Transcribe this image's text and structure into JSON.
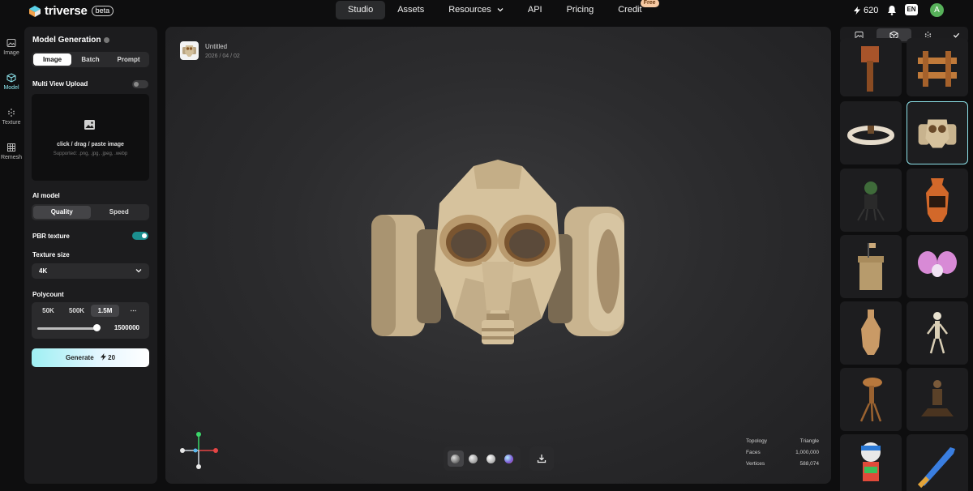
{
  "brand": {
    "name": "triverse",
    "badge": "beta"
  },
  "nav": {
    "items": [
      {
        "label": "Studio"
      },
      {
        "label": "Assets"
      },
      {
        "label": "Resources"
      },
      {
        "label": "API"
      },
      {
        "label": "Pricing"
      },
      {
        "label": "Credit"
      }
    ],
    "credit_badge": "Free"
  },
  "user": {
    "credits": "620",
    "language": "EN",
    "avatar_initial": "A"
  },
  "rail": {
    "items": [
      {
        "label": "Image"
      },
      {
        "label": "Model"
      },
      {
        "label": "Texture"
      },
      {
        "label": "Remesh"
      }
    ]
  },
  "panel": {
    "title": "Model Generation",
    "mode_tabs": [
      "Image",
      "Batch",
      "Prompt"
    ],
    "multi_view_label": "Multi View Upload",
    "multi_view_on": false,
    "upload_main": "click / drag / paste image",
    "upload_sub": "Supported: .png, .jpg, .jpeg, .webp",
    "ai_model_label": "AI model",
    "ai_model_options": [
      "Quality",
      "Speed"
    ],
    "pbr_label": "PBR texture",
    "pbr_on": true,
    "texture_size_label": "Texture size",
    "texture_size_value": "4K",
    "polycount_label": "Polycount",
    "polycount_options": [
      "50K",
      "500K",
      "1.5M",
      "⋯"
    ],
    "polycount_value": "1500000",
    "polycount_slider_fraction": 1.0,
    "generate_label": "Generate",
    "generate_cost": "20"
  },
  "viewport": {
    "title": "Untitled",
    "date": "2026 / 04 / 02",
    "stats": [
      {
        "label": "Topology",
        "value": "Triangle"
      },
      {
        "label": "Faces",
        "value": "1,000,000"
      },
      {
        "label": "Vertices",
        "value": "588,074"
      }
    ]
  },
  "colors": {
    "accent": "#8ee3ea",
    "toggle_on": "#1b8f8f",
    "avatar": "#57b15a",
    "badge": "#f6c9a3"
  }
}
